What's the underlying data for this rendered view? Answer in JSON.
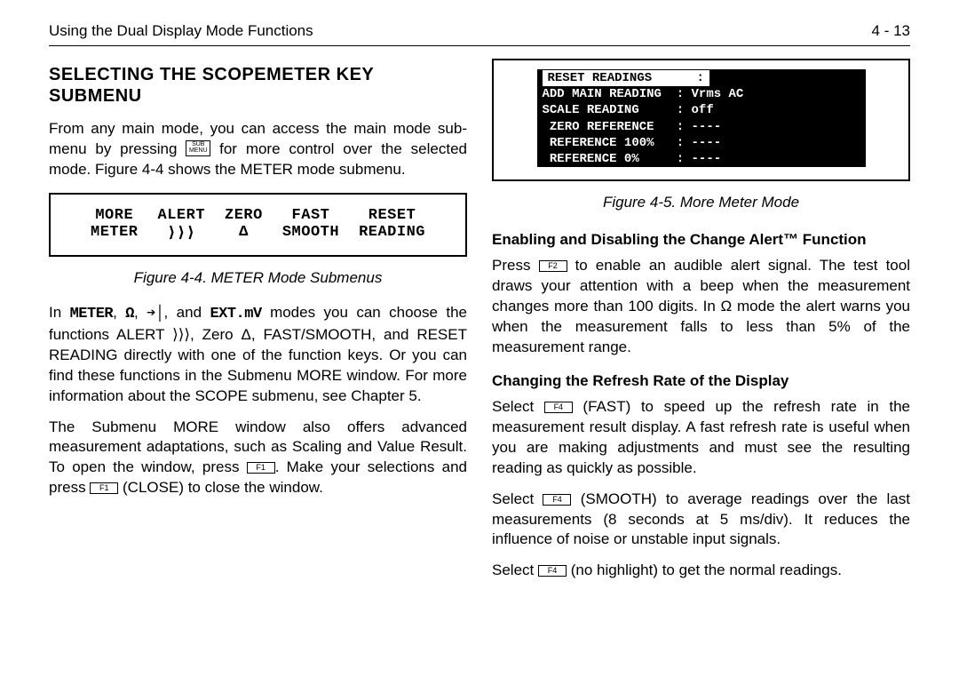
{
  "header": {
    "left": "Using the Dual Display Mode Functions",
    "right": "4 - 13"
  },
  "left_col": {
    "heading": "SELECTING THE SCOPEMETER KEY SUBMENU",
    "p1a": "From any main mode, you can access the main mode sub-menu by pressing ",
    "key_sub": "SUB\nMENU",
    "p1b": " for more control over the selected mode. Figure 4-4 shows the METER mode submenu.",
    "fig4": {
      "menu_row1": [
        "MORE",
        "ALERT",
        "ZERO",
        "FAST",
        "RESET"
      ],
      "menu_row2": [
        "METER",
        "⟩⟩⟩",
        "Δ",
        "SMOOTH",
        "READING"
      ],
      "caption": "Figure 4-4.   METER Mode Submenus"
    },
    "p2a": "In ",
    "mode1": "METER",
    "p2b": ", ",
    "mode2": "Ω",
    "p2c": ", ",
    "mode3": "➔│",
    "p2d": ", and ",
    "mode4": "EXT.mV",
    "p2e": " modes you can choose the functions ALERT ⟩⟩⟩, Zero Δ, FAST/SMOOTH, and RESET READING directly with one of the function keys. Or you can find these functions in the Submenu MORE window. For more information about the SCOPE submenu, see Chapter 5.",
    "p3a": "The Submenu MORE window also offers advanced measurement adaptations, such as Scaling and Value Result. To open the window, press ",
    "key_f1a": "F1",
    "p3b": ". Make your selections and press ",
    "key_f1b": "F1",
    "p3c": " (CLOSE) to close the window."
  },
  "right_col": {
    "fig5": {
      "line1_inv": "RESET READINGS      :",
      "line1b": "",
      "line2": "ADD MAIN READING  : Vrms AC",
      "line3": "SCALE READING     : off",
      "line4": " ZERO REFERENCE   : ----",
      "line5": " REFERENCE 100%   : ----",
      "line6": " REFERENCE 0%     : ----",
      "caption": "Figure 4-5.   More Meter Mode"
    },
    "sub1": "Enabling and Disabling the Change Alert™ Function",
    "p1a": "Press ",
    "key_f2": "F2",
    "p1b": " to enable an audible alert signal. The test tool draws your attention with a beep when the measurement changes more than 100 digits. In Ω mode the alert warns you when the measurement falls to less than 5% of the measurement range.",
    "sub2": "Changing the Refresh Rate of the Display",
    "p2a": "Select ",
    "key_f4a": "F4",
    "p2b": " (FAST) to speed up the refresh rate in the measurement result display. A fast refresh rate is useful when you are making adjustments and must see the resulting reading as quickly as possible.",
    "p3a": "Select ",
    "key_f4b": "F4",
    "p3b": " (SMOOTH) to average readings over the last measurements (8 seconds at 5 ms/div). It reduces the influence of noise or unstable input signals.",
    "p4a": "Select ",
    "key_f4c": "F4",
    "p4b": " (no highlight) to get the normal readings."
  }
}
